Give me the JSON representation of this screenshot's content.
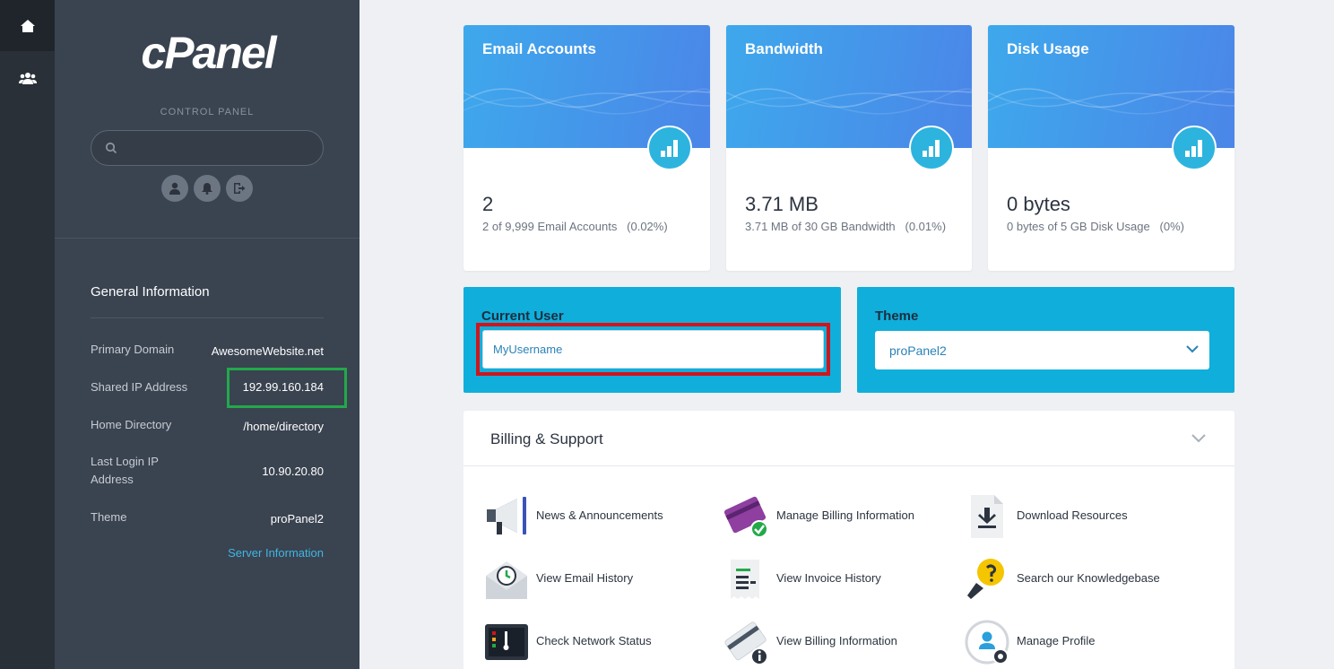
{
  "rail": {
    "home_icon": "home-icon",
    "users_icon": "users-icon"
  },
  "sidebar": {
    "logo": "cPanel",
    "subtitle": "CONTROL PANEL",
    "search": {
      "value": "",
      "placeholder": ""
    }
  },
  "general_info": {
    "title": "General Information",
    "rows": [
      {
        "label": "Primary Domain",
        "value": "AwesomeWebsite.net"
      },
      {
        "label": "Shared IP Address",
        "value": "192.99.160.184"
      },
      {
        "label": "Home Directory",
        "value": "/home/directory"
      },
      {
        "label": "Last Login IP Address",
        "value": "10.90.20.80"
      },
      {
        "label": "Theme",
        "value": "proPanel2"
      }
    ],
    "server_link": "Server Information"
  },
  "stats": [
    {
      "title": "Email Accounts",
      "value": "2",
      "detail": "2 of 9,999 Email Accounts",
      "percent": "(0.02%)"
    },
    {
      "title": "Bandwidth",
      "value": "3.71 MB",
      "detail": "3.71 MB of 30 GB Bandwidth",
      "percent": "(0.01%)"
    },
    {
      "title": "Disk Usage",
      "value": "0 bytes",
      "detail": "0 bytes of 5 GB Disk Usage",
      "percent": "(0%)"
    }
  ],
  "current_user": {
    "label": "Current User",
    "value": "MyUsername"
  },
  "theme": {
    "label": "Theme",
    "selected": "proPanel2"
  },
  "billing": {
    "title": "Billing & Support",
    "items": [
      {
        "label": "News & Announcements",
        "icon": "megaphone-icon"
      },
      {
        "label": "Manage Billing Information",
        "icon": "credit-card-check-icon"
      },
      {
        "label": "Download Resources",
        "icon": "download-file-icon"
      },
      {
        "label": "View Email History",
        "icon": "email-history-icon"
      },
      {
        "label": "View Invoice History",
        "icon": "invoice-icon"
      },
      {
        "label": "Search our Knowledgebase",
        "icon": "lightbulb-search-icon"
      },
      {
        "label": "Check Network Status",
        "icon": "network-status-icon"
      },
      {
        "label": "View Billing Information",
        "icon": "billing-info-icon"
      },
      {
        "label": "Manage Profile",
        "icon": "profile-gear-icon"
      }
    ]
  },
  "colors": {
    "accent": "#10aedb",
    "sidebar": "#3a4350",
    "rail": "#293038",
    "highlight_green": "#22a94a",
    "highlight_red": "#d0151c"
  }
}
